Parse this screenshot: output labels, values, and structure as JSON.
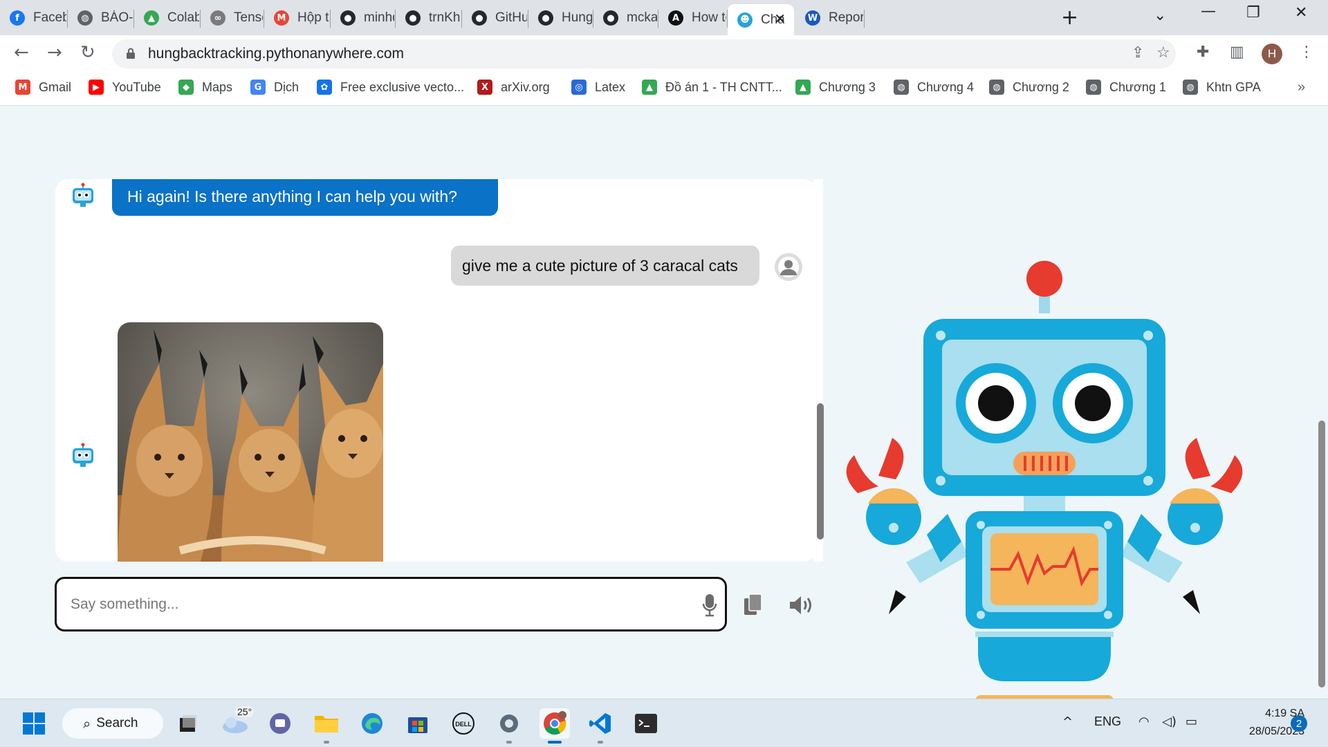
{
  "browser": {
    "tabs": [
      {
        "label": "Facebo",
        "favicon": "facebook-icon",
        "color": "#1877f2",
        "glyph": "f"
      },
      {
        "label": "BÁO-C",
        "favicon": "globe-icon",
        "color": "#5f6368",
        "glyph": "◍"
      },
      {
        "label": "Colab",
        "favicon": "google-drive-icon",
        "color": "#34a853",
        "glyph": "▲"
      },
      {
        "label": "Tensor",
        "favicon": "colab-icon",
        "color": "#7a7a7a",
        "glyph": "∞"
      },
      {
        "label": "Hộp th",
        "favicon": "gmail-icon",
        "color": "#ea4335",
        "glyph": "M"
      },
      {
        "label": "minhq",
        "favicon": "github-icon",
        "color": "#24292f",
        "glyph": "●"
      },
      {
        "label": "trnKha",
        "favicon": "github-icon",
        "color": "#24292f",
        "glyph": "●"
      },
      {
        "label": "GitHub",
        "favicon": "github-icon",
        "color": "#24292f",
        "glyph": "●"
      },
      {
        "label": "HungB",
        "favicon": "github-icon",
        "color": "#24292f",
        "glyph": "●"
      },
      {
        "label": "mckay",
        "favicon": "github-icon",
        "color": "#24292f",
        "glyph": "●"
      },
      {
        "label": "How to",
        "favicon": "ai-icon",
        "color": "#111111",
        "glyph": "A"
      },
      {
        "label": "Cha",
        "favicon": "chatbot-icon",
        "color": "#29a3d6",
        "glyph": "☻",
        "active": true
      },
      {
        "label": "Report",
        "favicon": "word-icon",
        "color": "#185abd",
        "glyph": "W"
      }
    ],
    "url": "hungbacktracking.pythonanywhere.com",
    "profile_initial": "H",
    "bookmarks": [
      {
        "label": "Gmail",
        "icon": "gmail-icon",
        "color": "#ea4335",
        "glyph": "M"
      },
      {
        "label": "YouTube",
        "icon": "youtube-icon",
        "color": "#ff0000",
        "glyph": "▶"
      },
      {
        "label": "Maps",
        "icon": "maps-icon",
        "color": "#34a853",
        "glyph": "◆"
      },
      {
        "label": "Dịch",
        "icon": "translate-icon",
        "color": "#4285f4",
        "glyph": "G"
      },
      {
        "label": "Free exclusive vecto...",
        "icon": "freepik-icon",
        "color": "#1273eb",
        "glyph": "✿"
      },
      {
        "label": "arXiv.org",
        "icon": "arxiv-icon",
        "color": "#b31b1b",
        "glyph": "X"
      },
      {
        "label": "Latex",
        "icon": "overleaf-icon",
        "color": "#2a6ad8",
        "glyph": "◎"
      },
      {
        "label": "Đồ án 1 - TH CNTT...",
        "icon": "google-drive-icon",
        "color": "#34a853",
        "glyph": "▲"
      },
      {
        "label": "Chương 3",
        "icon": "google-drive-icon",
        "color": "#34a853",
        "glyph": "▲"
      },
      {
        "label": "Chương 4",
        "icon": "globe-icon",
        "color": "#5f6368",
        "glyph": "◍"
      },
      {
        "label": "Chương 2",
        "icon": "globe-icon",
        "color": "#5f6368",
        "glyph": "◍"
      },
      {
        "label": "Chương 1",
        "icon": "globe-icon",
        "color": "#5f6368",
        "glyph": "◍"
      },
      {
        "label": "Khtn GPA",
        "icon": "globe-icon",
        "color": "#5f6368",
        "glyph": "◍"
      }
    ]
  },
  "chat": {
    "messages": [
      {
        "sender": "bot",
        "type": "text",
        "text": "Hi again! Is there anything I can help you with?"
      },
      {
        "sender": "user",
        "type": "text",
        "text": "give me a cute picture of 3 caracal cats"
      },
      {
        "sender": "bot",
        "type": "image",
        "subject": "three caracal cats"
      }
    ],
    "input_placeholder": "Say something...",
    "colors": {
      "bot_bubble": "#0a72c7",
      "user_bubble": "#d9d9d9"
    }
  },
  "taskbar": {
    "search_label": "Search",
    "weather_temp": "25°",
    "language": "ENG",
    "time": "4:19 SA",
    "date": "28/05/2023",
    "notification_count": "2"
  }
}
